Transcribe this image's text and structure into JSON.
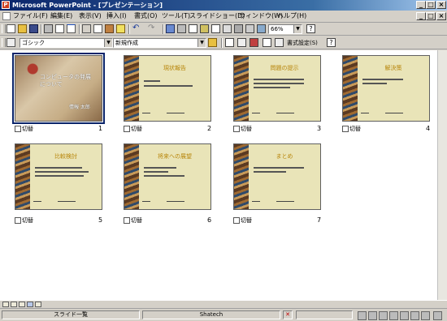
{
  "window": {
    "title": "Microsoft PowerPoint - [プレゼンテーション]",
    "minimize": "_",
    "maximize": "□",
    "close": "×",
    "doc_minimize": "_",
    "doc_restore": "□",
    "doc_close": "×"
  },
  "menu": [
    "ファイル(F)",
    "編集(E)",
    "表示(V)",
    "挿入(I)",
    "書式(O)",
    "ツール(T)",
    "スライドショー(D)",
    "ウィンドウ(W)",
    "ヘルプ(H)"
  ],
  "toolbar1": {
    "zoom": "66%",
    "zoom_arrow": "▼"
  },
  "toolbar2": {
    "font_name": "ゴシック",
    "design": "新規作成",
    "layout": "書式設定(S)"
  },
  "slides": [
    {
      "number": "1",
      "title": "コンピュータの発展について",
      "subtitle": "情報 太郎",
      "label": "切替"
    },
    {
      "number": "2",
      "title": "現状報告",
      "label": "切替"
    },
    {
      "number": "3",
      "title": "問題の提示",
      "label": "切替"
    },
    {
      "number": "4",
      "title": "解決策",
      "label": "切替"
    },
    {
      "number": "5",
      "title": "比較検討",
      "label": "切替"
    },
    {
      "number": "6",
      "title": "将来への展望",
      "label": "切替"
    },
    {
      "number": "7",
      "title": "まとめ",
      "label": "切替"
    }
  ],
  "status": {
    "view": "スライド一覧",
    "design": "Shatech"
  }
}
